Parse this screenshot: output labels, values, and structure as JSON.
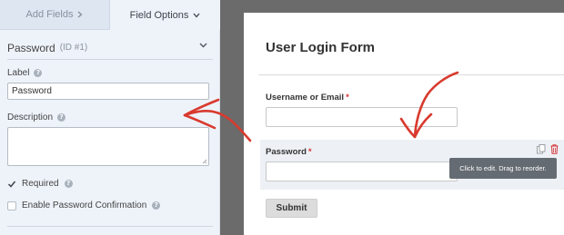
{
  "tabs": {
    "add_fields": "Add Fields",
    "field_options": "Field Options"
  },
  "field": {
    "name": "Password",
    "id": "(ID #1)"
  },
  "options": {
    "label_title": "Label",
    "label_value": "Password",
    "description_title": "Description",
    "description_value": "",
    "required_label": "Required",
    "required_checked": true,
    "confirmation_label": "Enable Password Confirmation",
    "confirmation_checked": false
  },
  "form": {
    "title": "User Login Form",
    "username_label": "Username or Email",
    "password_label": "Password",
    "required_marker": "*",
    "tooltip": "Click to edit. Drag to reorder.",
    "submit_label": "Submit"
  },
  "colors": {
    "accent_red": "#d63638",
    "annotation_red": "#d93a2e",
    "panel_bg": "#eef3fa",
    "canvas_gray": "#6b6b6b"
  }
}
